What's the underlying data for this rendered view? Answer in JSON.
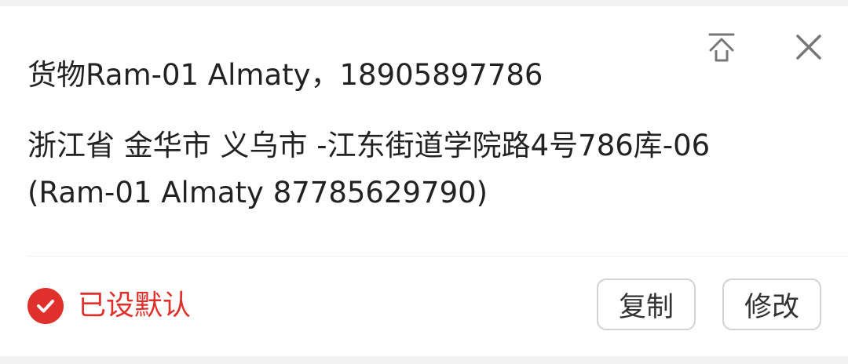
{
  "header": {
    "pin_icon": "pin-to-top-icon",
    "close_icon": "close-icon"
  },
  "recipient": {
    "line": "货物Ram-01 Almaty，18905897786"
  },
  "address": {
    "line1": "浙江省 金华市 义乌市 -江东街道学院路4号786库-06",
    "line2": "(Ram-01 Almaty 87785629790)"
  },
  "footer": {
    "default_label": "已设默认",
    "check_icon": "check-circle-icon",
    "copy_label": "复制",
    "edit_label": "修改"
  },
  "colors": {
    "accent_red": "#e0302b",
    "text": "#222222",
    "border": "#d3d3d3"
  }
}
